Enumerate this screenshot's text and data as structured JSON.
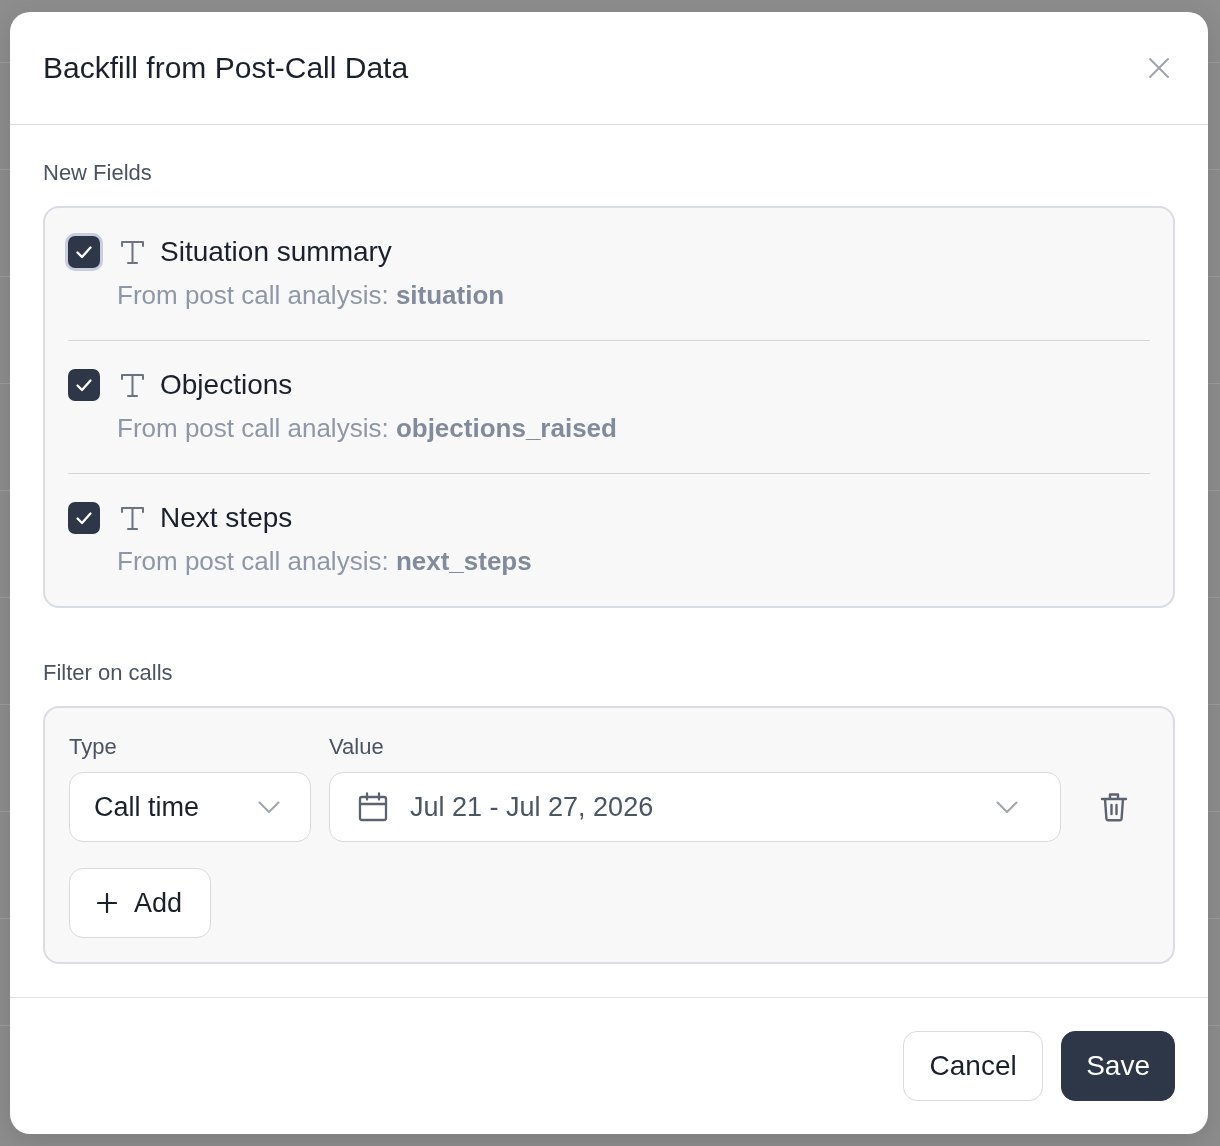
{
  "dialog": {
    "title": "Backfill from Post-Call Data"
  },
  "new_fields": {
    "label": "New Fields",
    "items": [
      {
        "name": "Situation summary",
        "source": "From post call analysis: **situation**",
        "checked": true,
        "focused": true
      },
      {
        "name": "Objections",
        "source": "From post call analysis: **objections_raised**",
        "checked": true,
        "focused": false
      },
      {
        "name": "Next steps",
        "source": "From post call analysis: **next_steps**",
        "checked": true,
        "focused": false
      }
    ]
  },
  "filter": {
    "label": "Filter on calls",
    "rows": [
      {
        "type_label": "Type",
        "type_value": "Call time",
        "value_label": "Value",
        "value": "Jul 21 - Jul 27, 2026"
      }
    ],
    "add_button": "Add"
  },
  "footer": {
    "buttons": [
      {
        "label": "Cancel",
        "kind": "secondary"
      },
      {
        "label": "Save",
        "kind": "primary"
      }
    ]
  }
}
